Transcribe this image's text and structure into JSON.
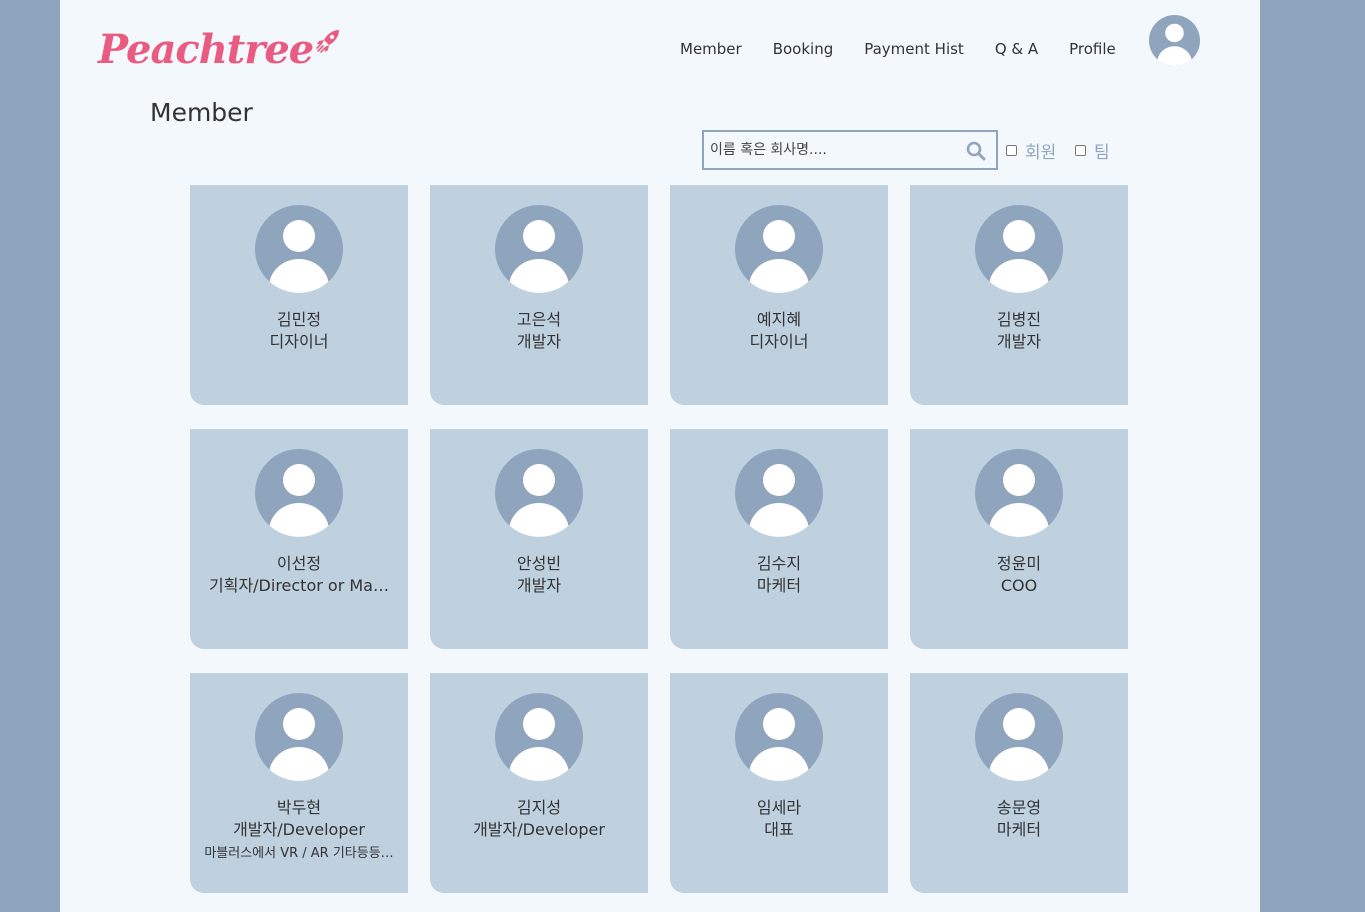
{
  "brand": {
    "name": "Peachtree",
    "color": "#ea5b82"
  },
  "nav": {
    "items": [
      "Member",
      "Booking",
      "Payment Hist",
      "Q & A",
      "Profile"
    ],
    "avatar_icon": "user-avatar-icon"
  },
  "page": {
    "title": "Member"
  },
  "search": {
    "placeholder": "이름 혹은 회사명....",
    "value": "",
    "icon": "search-icon"
  },
  "filters": {
    "member_label": "회원",
    "team_label": "팀",
    "member_checked": false,
    "team_checked": false
  },
  "members": [
    {
      "name": "김민정",
      "role": "디자이너",
      "desc": ""
    },
    {
      "name": "고은석",
      "role": "개발자",
      "desc": ""
    },
    {
      "name": "예지혜",
      "role": "디자이너",
      "desc": ""
    },
    {
      "name": "김병진",
      "role": "개발자",
      "desc": ""
    },
    {
      "name": "이선정",
      "role": "기획자/Director or Ma…",
      "desc": ""
    },
    {
      "name": "안성빈",
      "role": "개발자",
      "desc": ""
    },
    {
      "name": "김수지",
      "role": "마케터",
      "desc": ""
    },
    {
      "name": "정윤미",
      "role": "COO",
      "desc": ""
    },
    {
      "name": "박두현",
      "role": "개발자/Developer",
      "desc": "마블러스에서 VR / AR 기타등등…"
    },
    {
      "name": "김지성",
      "role": "개발자/Developer",
      "desc": ""
    },
    {
      "name": "임세라",
      "role": "대표",
      "desc": ""
    },
    {
      "name": "송문영",
      "role": "마케터",
      "desc": ""
    }
  ],
  "colors": {
    "outer_bg": "#8fa5be",
    "page_bg": "#f3f8fd",
    "card_bg": "#bfd0df",
    "avatar_bg": "#8fa5be"
  }
}
